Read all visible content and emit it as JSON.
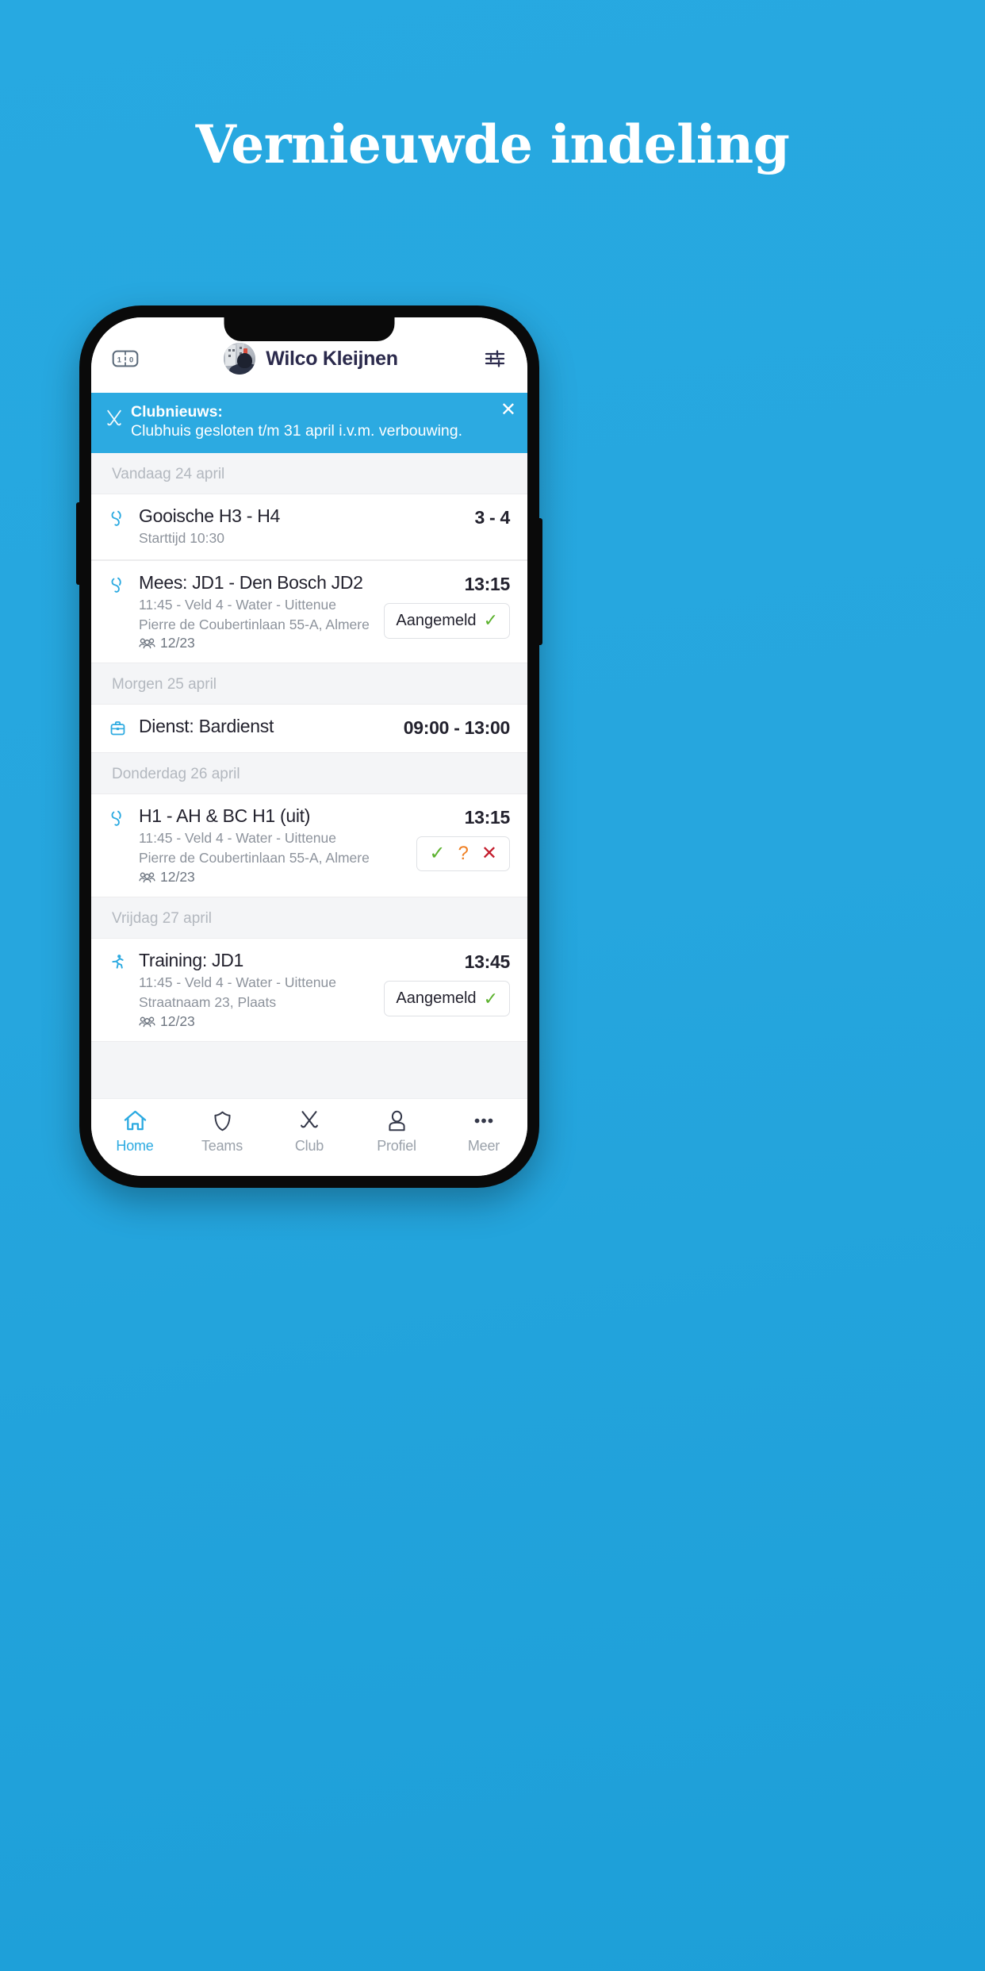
{
  "promo": {
    "headline": "Vernieuwde indeling",
    "background_color": "#27a9e1"
  },
  "app": {
    "accent_color": "#2caae1",
    "header": {
      "score_icon": "scoreboard-icon",
      "score_left": "1",
      "score_right": "0",
      "avatar_icon": "user-avatar",
      "user_name": "Wilco Kleijnen",
      "settings_icon": "sliders-filter-icon"
    },
    "banner": {
      "icon": "crossed-hockey-sticks-icon",
      "title": "Clubnieuws:",
      "body": "Clubhuis gesloten t/m 31 april i.v.m. verbouwing.",
      "close_icon": "close-icon",
      "background_color": "#2caae1"
    },
    "agenda": [
      {
        "day": "Vandaag 24 april",
        "items": [
          {
            "icon": "hockey-sticks-icon",
            "title": "Gooische H3 - H4",
            "lines": [
              "Starttijd 10:30"
            ],
            "attendance": null,
            "time": "3 - 4",
            "action": null
          }
        ]
      },
      {
        "day": "Morgen 25 april",
        "items": [
          {
            "icon": "briefcase-icon",
            "title": "Mees: JD1 - Den Bosch JD2",
            "lines": [
              "11:45 - Veld 4 - Water - Uittenue",
              "Pierre de Coubertinlaan 55-A, Almere"
            ],
            "attendance": "12/23",
            "time": "13:15",
            "action": {
              "type": "status",
              "label": "Aangemeld",
              "icon": "check-icon",
              "color": "#5cb22e"
            }
          }
        ]
      },
      {
        "day": "Donderdag 26 april",
        "items": [
          {
            "icon": "briefcase-icon",
            "title": "Dienst: Bardienst",
            "lines": [],
            "attendance": null,
            "time": "09:00 - 13:00",
            "action": null
          },
          {
            "icon": "hockey-sticks-icon",
            "title": "H1 - AH & BC H1 (uit)",
            "lines": [
              "11:45 - Veld 4 - Water - Uittenue",
              "Pierre de Coubertinlaan 55-A, Almere"
            ],
            "attendance": "12/23",
            "time": "13:15",
            "action": {
              "type": "choice",
              "options": [
                {
                  "icon": "check-icon",
                  "glyph": "✓",
                  "color": "#5cb22e",
                  "name": "yes"
                },
                {
                  "icon": "question-icon",
                  "glyph": "?",
                  "color": "#ef7f22",
                  "name": "maybe"
                },
                {
                  "icon": "cross-icon",
                  "glyph": "✕",
                  "color": "#c41e2e",
                  "name": "no"
                }
              ]
            }
          }
        ]
      },
      {
        "day": "Vrijdag 27 april",
        "items": [
          {
            "icon": "running-person-icon",
            "title": "Training: JD1",
            "lines": [
              "11:45 - Veld 4 - Water - Uittenue",
              "Straatnaam 23, Plaats"
            ],
            "attendance": "12/23",
            "time": "13:45",
            "action": {
              "type": "status",
              "label": "Aangemeld",
              "icon": "check-icon",
              "color": "#5cb22e"
            }
          }
        ]
      }
    ],
    "tabs": [
      {
        "label": "Home",
        "icon": "home-icon",
        "active": true
      },
      {
        "label": "Teams",
        "icon": "shield-icon",
        "active": false
      },
      {
        "label": "Club",
        "icon": "crossed-sticks-icon",
        "active": false
      },
      {
        "label": "Profiel",
        "icon": "person-icon",
        "active": false
      },
      {
        "label": "Meer",
        "icon": "ellipsis-icon",
        "active": false
      }
    ]
  }
}
